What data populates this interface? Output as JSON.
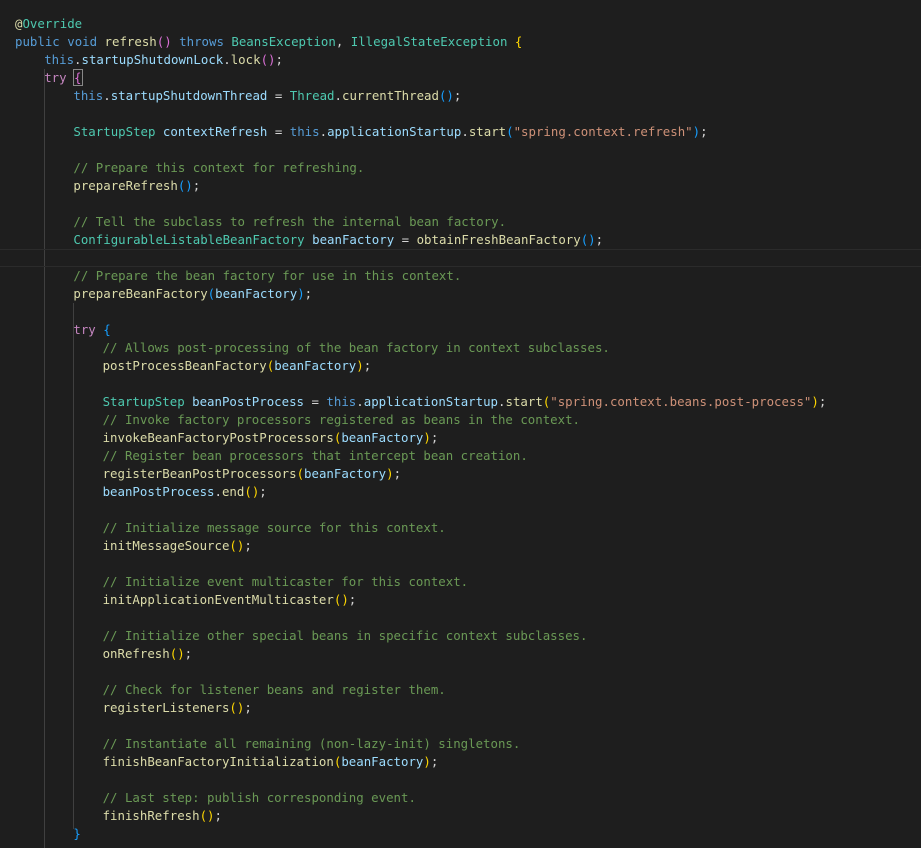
{
  "editor": {
    "language": "java",
    "lines": [
      {
        "indent": 0,
        "tokens": [
          [
            "an",
            "@"
          ],
          [
            "ty",
            "Override"
          ]
        ]
      },
      {
        "indent": 0,
        "tokens": [
          [
            "kw",
            "public"
          ],
          [
            "pl",
            " "
          ],
          [
            "kw",
            "void"
          ],
          [
            "pl",
            " "
          ],
          [
            "fn",
            "refresh"
          ],
          [
            "b2",
            "()"
          ],
          [
            "pl",
            " "
          ],
          [
            "kw",
            "throws"
          ],
          [
            "pl",
            " "
          ],
          [
            "ty",
            "BeansException"
          ],
          [
            "pl",
            ", "
          ],
          [
            "ty",
            "IllegalStateException"
          ],
          [
            "pl",
            " "
          ],
          [
            "b1",
            "{"
          ]
        ]
      },
      {
        "indent": 1,
        "tokens": [
          [
            "kw",
            "this"
          ],
          [
            "pl",
            "."
          ],
          [
            "var",
            "startupShutdownLock"
          ],
          [
            "pl",
            "."
          ],
          [
            "fn",
            "lock"
          ],
          [
            "b2",
            "()"
          ],
          [
            "pl",
            ";"
          ]
        ]
      },
      {
        "indent": 1,
        "tokens": [
          [
            "kw2",
            "try"
          ],
          [
            "pl",
            " "
          ],
          [
            "b2",
            "{"
          ]
        ]
      },
      {
        "indent": 2,
        "tokens": [
          [
            "kw",
            "this"
          ],
          [
            "pl",
            "."
          ],
          [
            "var",
            "startupShutdownThread"
          ],
          [
            "pl",
            " = "
          ],
          [
            "ty",
            "Thread"
          ],
          [
            "pl",
            "."
          ],
          [
            "fn",
            "currentThread"
          ],
          [
            "b3",
            "()"
          ],
          [
            "pl",
            ";"
          ]
        ]
      },
      {
        "indent": 0,
        "tokens": []
      },
      {
        "indent": 2,
        "tokens": [
          [
            "ty",
            "StartupStep"
          ],
          [
            "pl",
            " "
          ],
          [
            "var",
            "contextRefresh"
          ],
          [
            "pl",
            " = "
          ],
          [
            "kw",
            "this"
          ],
          [
            "pl",
            "."
          ],
          [
            "var",
            "applicationStartup"
          ],
          [
            "pl",
            "."
          ],
          [
            "fn",
            "start"
          ],
          [
            "b3",
            "("
          ],
          [
            "str",
            "\"spring.context.refresh\""
          ],
          [
            "b3",
            ")"
          ],
          [
            "pl",
            ";"
          ]
        ]
      },
      {
        "indent": 0,
        "tokens": []
      },
      {
        "indent": 2,
        "tokens": [
          [
            "cm",
            "// Prepare this context for refreshing."
          ]
        ]
      },
      {
        "indent": 2,
        "tokens": [
          [
            "fn",
            "prepareRefresh"
          ],
          [
            "b3",
            "()"
          ],
          [
            "pl",
            ";"
          ]
        ]
      },
      {
        "indent": 0,
        "tokens": []
      },
      {
        "indent": 2,
        "tokens": [
          [
            "cm",
            "// Tell the subclass to refresh the internal bean factory."
          ]
        ]
      },
      {
        "indent": 2,
        "tokens": [
          [
            "ty",
            "ConfigurableListableBeanFactory"
          ],
          [
            "pl",
            " "
          ],
          [
            "var",
            "beanFactory"
          ],
          [
            "pl",
            " = "
          ],
          [
            "fn",
            "obtainFreshBeanFactory"
          ],
          [
            "b3",
            "()"
          ],
          [
            "pl",
            ";"
          ]
        ]
      },
      {
        "indent": 0,
        "tokens": [],
        "current": true
      },
      {
        "indent": 2,
        "tokens": [
          [
            "cm",
            "// Prepare the bean factory for use in this context."
          ]
        ]
      },
      {
        "indent": 2,
        "tokens": [
          [
            "fn",
            "prepareBeanFactory"
          ],
          [
            "b3",
            "("
          ],
          [
            "var",
            "beanFactory"
          ],
          [
            "b3",
            ")"
          ],
          [
            "pl",
            ";"
          ]
        ]
      },
      {
        "indent": 0,
        "tokens": []
      },
      {
        "indent": 2,
        "tokens": [
          [
            "kw2",
            "try"
          ],
          [
            "pl",
            " "
          ],
          [
            "b3",
            "{"
          ]
        ]
      },
      {
        "indent": 3,
        "tokens": [
          [
            "cm",
            "// Allows post-processing of the bean factory in context subclasses."
          ]
        ]
      },
      {
        "indent": 3,
        "tokens": [
          [
            "fn",
            "postProcessBeanFactory"
          ],
          [
            "b1",
            "("
          ],
          [
            "var",
            "beanFactory"
          ],
          [
            "b1",
            ")"
          ],
          [
            "pl",
            ";"
          ]
        ]
      },
      {
        "indent": 0,
        "tokens": []
      },
      {
        "indent": 3,
        "tokens": [
          [
            "ty",
            "StartupStep"
          ],
          [
            "pl",
            " "
          ],
          [
            "var",
            "beanPostProcess"
          ],
          [
            "pl",
            " = "
          ],
          [
            "kw",
            "this"
          ],
          [
            "pl",
            "."
          ],
          [
            "var",
            "applicationStartup"
          ],
          [
            "pl",
            "."
          ],
          [
            "fn",
            "start"
          ],
          [
            "b1",
            "("
          ],
          [
            "str",
            "\"spring.context.beans.post-process\""
          ],
          [
            "b1",
            ")"
          ],
          [
            "pl",
            ";"
          ]
        ]
      },
      {
        "indent": 3,
        "tokens": [
          [
            "cm",
            "// Invoke factory processors registered as beans in the context."
          ]
        ]
      },
      {
        "indent": 3,
        "tokens": [
          [
            "fn",
            "invokeBeanFactoryPostProcessors"
          ],
          [
            "b1",
            "("
          ],
          [
            "var",
            "beanFactory"
          ],
          [
            "b1",
            ")"
          ],
          [
            "pl",
            ";"
          ]
        ]
      },
      {
        "indent": 3,
        "tokens": [
          [
            "cm",
            "// Register bean processors that intercept bean creation."
          ]
        ]
      },
      {
        "indent": 3,
        "tokens": [
          [
            "fn",
            "registerBeanPostProcessors"
          ],
          [
            "b1",
            "("
          ],
          [
            "var",
            "beanFactory"
          ],
          [
            "b1",
            ")"
          ],
          [
            "pl",
            ";"
          ]
        ]
      },
      {
        "indent": 3,
        "tokens": [
          [
            "var",
            "beanPostProcess"
          ],
          [
            "pl",
            "."
          ],
          [
            "fn",
            "end"
          ],
          [
            "b1",
            "()"
          ],
          [
            "pl",
            ";"
          ]
        ]
      },
      {
        "indent": 0,
        "tokens": []
      },
      {
        "indent": 3,
        "tokens": [
          [
            "cm",
            "// Initialize message source for this context."
          ]
        ]
      },
      {
        "indent": 3,
        "tokens": [
          [
            "fn",
            "initMessageSource"
          ],
          [
            "b1",
            "()"
          ],
          [
            "pl",
            ";"
          ]
        ]
      },
      {
        "indent": 0,
        "tokens": []
      },
      {
        "indent": 3,
        "tokens": [
          [
            "cm",
            "// Initialize event multicaster for this context."
          ]
        ]
      },
      {
        "indent": 3,
        "tokens": [
          [
            "fn",
            "initApplicationEventMulticaster"
          ],
          [
            "b1",
            "()"
          ],
          [
            "pl",
            ";"
          ]
        ]
      },
      {
        "indent": 0,
        "tokens": []
      },
      {
        "indent": 3,
        "tokens": [
          [
            "cm",
            "// Initialize other special beans in specific context subclasses."
          ]
        ]
      },
      {
        "indent": 3,
        "tokens": [
          [
            "fn",
            "onRefresh"
          ],
          [
            "b1",
            "()"
          ],
          [
            "pl",
            ";"
          ]
        ]
      },
      {
        "indent": 0,
        "tokens": []
      },
      {
        "indent": 3,
        "tokens": [
          [
            "cm",
            "// Check for listener beans and register them."
          ]
        ]
      },
      {
        "indent": 3,
        "tokens": [
          [
            "fn",
            "registerListeners"
          ],
          [
            "b1",
            "()"
          ],
          [
            "pl",
            ";"
          ]
        ]
      },
      {
        "indent": 0,
        "tokens": []
      },
      {
        "indent": 3,
        "tokens": [
          [
            "cm",
            "// Instantiate all remaining (non-lazy-init) singletons."
          ]
        ]
      },
      {
        "indent": 3,
        "tokens": [
          [
            "fn",
            "finishBeanFactoryInitialization"
          ],
          [
            "b1",
            "("
          ],
          [
            "var",
            "beanFactory"
          ],
          [
            "b1",
            ")"
          ],
          [
            "pl",
            ";"
          ]
        ]
      },
      {
        "indent": 0,
        "tokens": []
      },
      {
        "indent": 3,
        "tokens": [
          [
            "cm",
            "// Last step: publish corresponding event."
          ]
        ]
      },
      {
        "indent": 3,
        "tokens": [
          [
            "fn",
            "finishRefresh"
          ],
          [
            "b1",
            "()"
          ],
          [
            "pl",
            ";"
          ]
        ]
      },
      {
        "indent": 2,
        "tokens": [
          [
            "b3",
            "}"
          ]
        ]
      }
    ]
  }
}
